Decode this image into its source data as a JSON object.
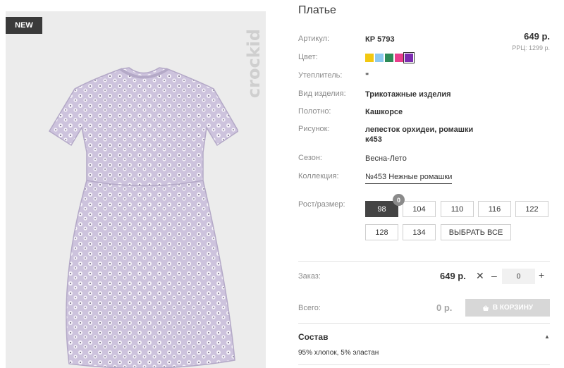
{
  "badge": "NEW",
  "brand": "crockid",
  "title": "Платье",
  "price": "649 р.",
  "rrp": "РРЦ: 1299 р.",
  "specs": {
    "article": {
      "label": "Артикул:",
      "value": "КР 5793"
    },
    "color": {
      "label": "Цвет:"
    },
    "insulation": {
      "label": "Утеплитель:",
      "value": "\""
    },
    "type": {
      "label": "Вид изделия:",
      "value": "Трикотажные изделия"
    },
    "fabric": {
      "label": "Полотно:",
      "value": "Кашкорсе"
    },
    "pattern": {
      "label": "Рисунок:",
      "value": "лепесток орхидеи, ромашки к453"
    },
    "season": {
      "label": "Сезон:",
      "value": "Весна-Лето"
    },
    "collection": {
      "label": "Коллекция:",
      "value": "№453 Нежные ромашки"
    }
  },
  "swatch_colors": [
    "#f2c811",
    "#8cc9ef",
    "#2e8b57",
    "#e83e8c",
    "#7b2cb0"
  ],
  "sizes": {
    "label": "Рост/размер:",
    "badge_count": "0",
    "items": [
      "98",
      "104",
      "110",
      "116",
      "122",
      "128",
      "134"
    ],
    "select_all": "ВЫБРАТЬ ВСЕ",
    "selected": "98"
  },
  "order": {
    "label": "Заказ:",
    "price": "649 р.",
    "quantity": "0",
    "total_label": "Всего:",
    "total": "0 р.",
    "cart_button": "В КОРЗИНУ"
  },
  "composition": {
    "title": "Состав",
    "text": "95% хлопок, 5% эластан"
  }
}
